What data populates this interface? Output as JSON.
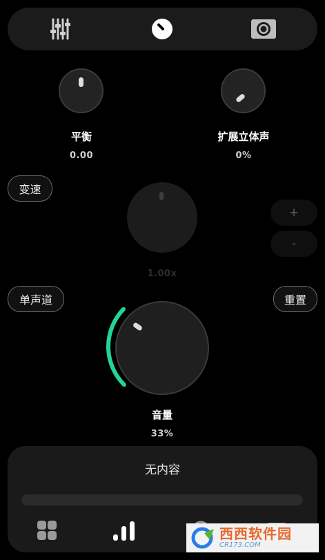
{
  "tabs": [
    {
      "icon": "equalizer-sliders-icon",
      "active": false
    },
    {
      "icon": "knob-icon",
      "active": true
    },
    {
      "icon": "speaker-icon",
      "active": false
    }
  ],
  "balance": {
    "label": "平衡",
    "value": "0.00"
  },
  "stereo": {
    "label": "扩展立体声",
    "value": "0%"
  },
  "speed": {
    "toggle_label": "变速",
    "value": "1.00x",
    "plus": "+",
    "minus": "-"
  },
  "mono_label": "单声道",
  "reset_label": "重置",
  "volume": {
    "label": "音量",
    "value": "33%",
    "level": 0.33,
    "accent": "#23d49a"
  },
  "player": {
    "title": "无内容",
    "progress": 0
  },
  "bottom_nav": [
    {
      "icon": "grid-icon",
      "active": false
    },
    {
      "icon": "bar-chart-icon",
      "active": true
    },
    {
      "icon": "headphones-icon",
      "active": false
    },
    {
      "icon": "menu-icon",
      "active": false
    }
  ],
  "watermark": {
    "brand": "西西软件园",
    "url": "CR173.COM"
  }
}
